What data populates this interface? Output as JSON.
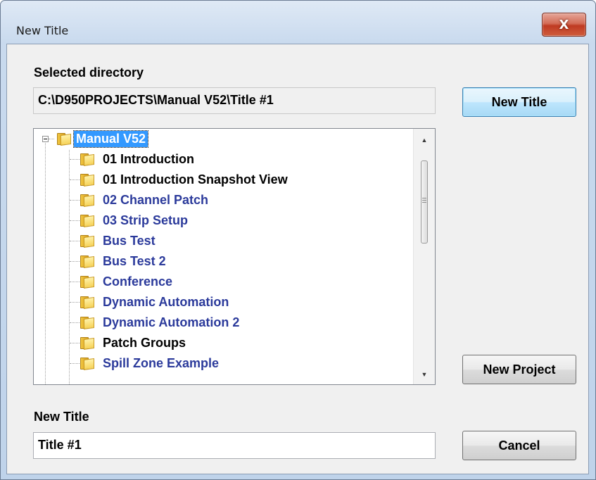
{
  "window": {
    "title": "New Title",
    "close_glyph": "X"
  },
  "directory": {
    "label": "Selected directory",
    "path": "C:\\D950PROJECTS\\Manual V52\\Title #1"
  },
  "buttons": {
    "new_title": "New Title",
    "new_project": "New Project",
    "cancel": "Cancel"
  },
  "tree": {
    "root": "Manual V52",
    "items": [
      {
        "label": "01 Introduction",
        "color": "#000000"
      },
      {
        "label": "01 Introduction Snapshot View",
        "color": "#000000"
      },
      {
        "label": "02 Channel Patch",
        "color": "#2b3a9b"
      },
      {
        "label": "03 Strip Setup",
        "color": "#2b3a9b"
      },
      {
        "label": "Bus Test",
        "color": "#2b3a9b"
      },
      {
        "label": "Bus Test 2",
        "color": "#2b3a9b"
      },
      {
        "label": "Conference",
        "color": "#2b3a9b"
      },
      {
        "label": "Dynamic Automation",
        "color": "#2b3a9b"
      },
      {
        "label": "Dynamic Automation 2",
        "color": "#2b3a9b"
      },
      {
        "label": "Patch Groups",
        "color": "#000000"
      },
      {
        "label": "Spill Zone Example",
        "color": "#2b3a9b"
      }
    ],
    "icons": {
      "folder": "folder-icon",
      "expander": "collapse-icon"
    }
  },
  "new_title": {
    "label": "New Title",
    "value": "Title #1"
  },
  "colors": {
    "selection": "#3399ff",
    "default_button_border": "#3c7fb1",
    "close_button": "#c7422a"
  }
}
